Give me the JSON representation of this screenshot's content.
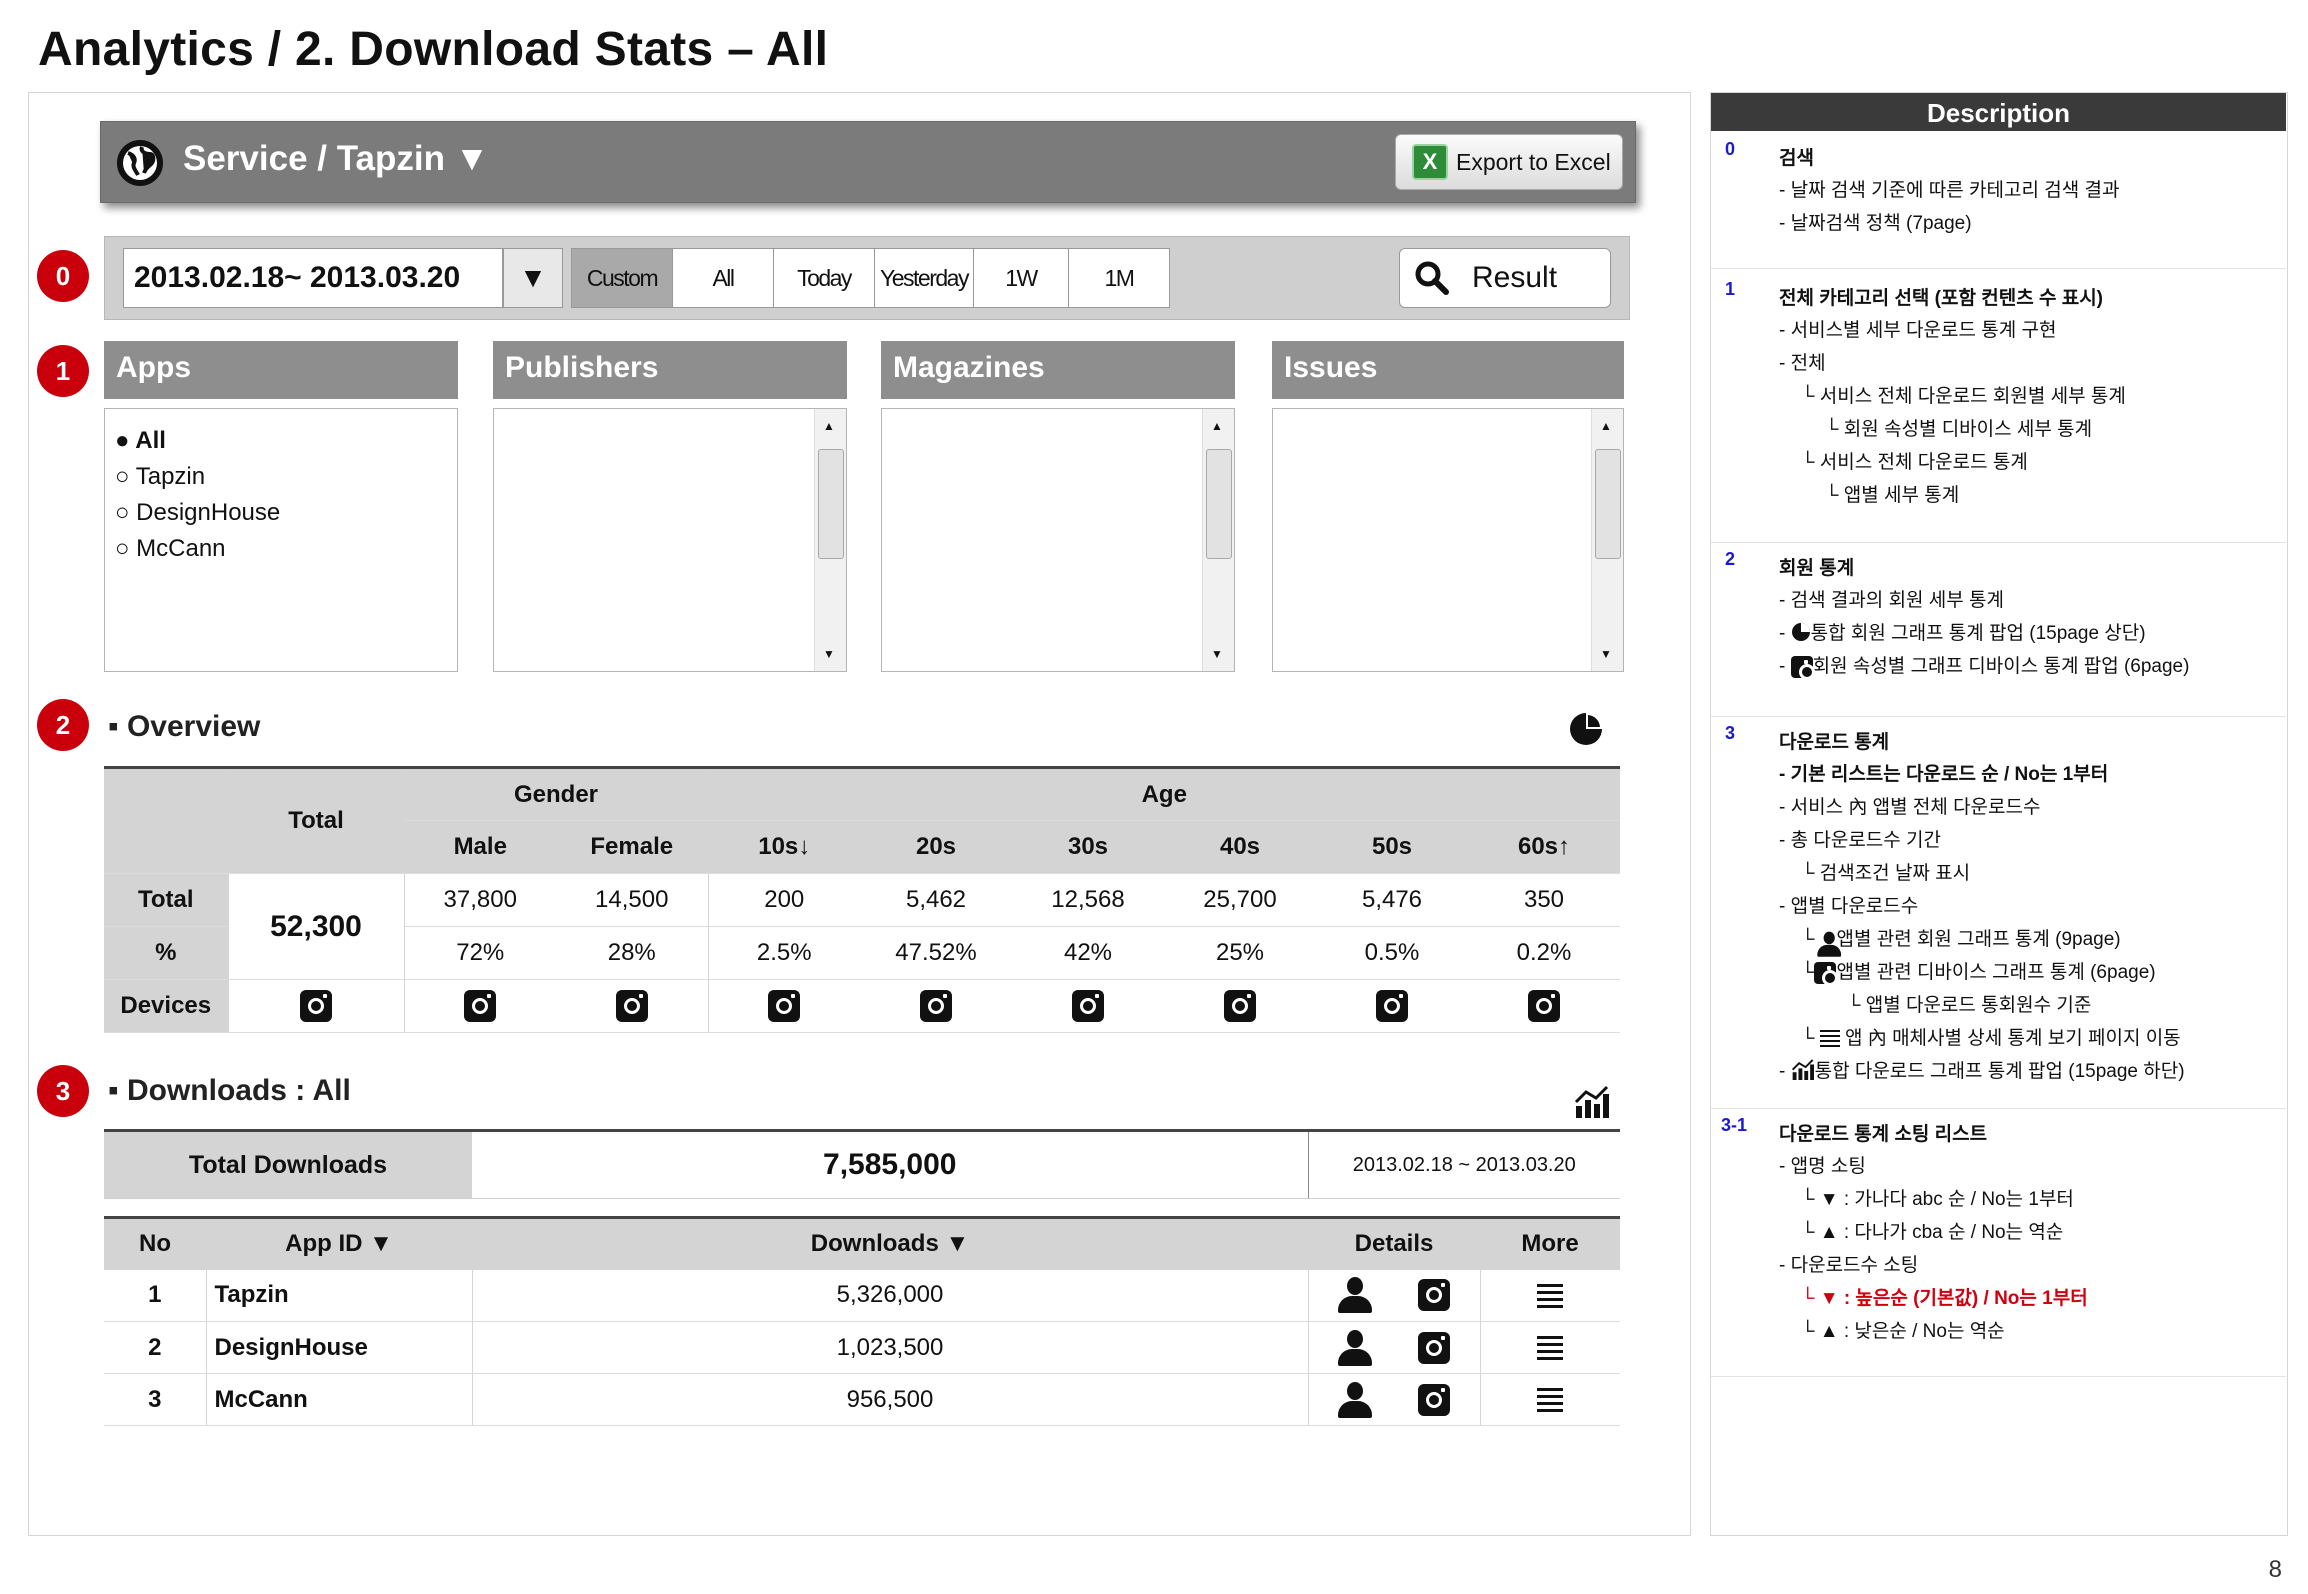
{
  "page": {
    "title": "Analytics / 2. Download Stats – All",
    "page_number": "8"
  },
  "header": {
    "service_title": "Service / Tapzin  ▼",
    "export_label": "Export to Excel"
  },
  "search": {
    "date_range": "2013.02.18~ 2013.03.20",
    "dropdown_glyph": "▼",
    "ranges": [
      "Custom",
      "All",
      "Today",
      "Yesterday",
      "1W",
      "1M"
    ],
    "selected_range": "Custom",
    "result_label": "Result"
  },
  "badges": [
    "0",
    "1",
    "2",
    "3"
  ],
  "categories": {
    "apps": {
      "title": "Apps",
      "items": [
        "● All",
        "○ Tapzin",
        "○ DesignHouse",
        "○ McCann"
      ]
    },
    "publishers": {
      "title": "Publishers"
    },
    "magazines": {
      "title": "Magazines"
    },
    "issues": {
      "title": "Issues"
    }
  },
  "overview": {
    "title": "▪ Overview",
    "header_total": "Total",
    "header_gender": "Gender",
    "header_age": "Age",
    "sub_headers": [
      "Male",
      "Female",
      "10s↓",
      "20s",
      "30s",
      "40s",
      "50s",
      "60s↑"
    ],
    "row_labels": [
      "Total",
      "%",
      "Devices"
    ],
    "total_value": "52,300",
    "totals": [
      "37,800",
      "14,500",
      "200",
      "5,462",
      "12,568",
      "25,700",
      "5,476",
      "350"
    ],
    "percents": [
      "72%",
      "28%",
      "2.5%",
      "47.52%",
      "42%",
      "25%",
      "0.5%",
      "0.2%"
    ]
  },
  "downloads": {
    "title": "▪ Downloads : All",
    "total_label": "Total Downloads",
    "total_value": "7,585,000",
    "date_range": "2013.02.18 ~ 2013.03.20",
    "headers": {
      "no": "No",
      "app_id": "App ID ▼",
      "downloads": "Downloads ▼",
      "details": "Details",
      "more": "More"
    },
    "rows": [
      {
        "no": "1",
        "app": "Tapzin",
        "downloads": "5,326,000"
      },
      {
        "no": "2",
        "app": "DesignHouse",
        "downloads": "1,023,500"
      },
      {
        "no": "3",
        "app": "McCann",
        "downloads": "956,500"
      }
    ]
  },
  "description": {
    "title": "Description",
    "s0": {
      "num": "0",
      "title": "검색",
      "lines": [
        "- 날짜 검색 기준에 따른 카테고리 검색 결과",
        "- 날짜검색 정책 (7page)"
      ]
    },
    "s1": {
      "num": "1",
      "title": "전체 카테고리 선택 (포함 컨텐츠 수 표시)",
      "lines": [
        "- 서비스별 세부 다운로드 통계 구현",
        "- 전체",
        "└ 서비스 전체 다운로드 회원별 세부 통계",
        "└ 회원 속성별 디바이스 세부 통계",
        "└ 서비스 전체 다운로드 통계",
        "└ 앱별 세부 통계"
      ]
    },
    "s2": {
      "num": "2",
      "title": "회원 통계",
      "lines": [
        "- 검색 결과의 회원 세부 통계",
        "통합 회원 그래프 통계 팝업 (15page 상단)",
        "회원 속성별 그래프 디바이스 통계 팝업 (6page)"
      ]
    },
    "s3": {
      "num": "3",
      "title": "다운로드 통계",
      "lines": [
        "- 기본 리스트는 다운로드 순 / No는 1부터",
        "- 서비스 內 앱별 전체 다운로드수",
        "- 총 다운로드수 기간",
        "└ 검색조건 날짜 표시",
        "- 앱별 다운로드수",
        "앱별 관련 회원 그래프 통계 (9page)",
        "앱별 관련 디바이스 그래프 통계 (6page)",
        "└ 앱별 다운로드 통회원수 기준",
        "앱 內 매체사별 상세 통계 보기 페이지 이동",
        "통합 다운로드 그래프 통계 팝업 (15page 하단)"
      ]
    },
    "s31": {
      "num": "3-1",
      "title": "다운로드 통계 소팅 리스트",
      "lines": [
        "- 앱명 소팅",
        "└ ▼ : 가나다 abc 순 / No는 1부터",
        "└ ▲ : 다나가 cba 순 / No는 역순",
        "-  다운로드수 소팅",
        "└ ▼ : 높은순 (기본값) / No는 1부터",
        "└ ▲ : 낮은순 / No는 역순"
      ]
    }
  },
  "colors": {
    "badge": "#c9000b",
    "header_bar": "#7b7b7b",
    "category_header": "#8e8e8e",
    "table_header": "#d4d4d4",
    "description_bar": "#3a3a3a",
    "desc_number": "#1a1ad0",
    "desc_highlight": "#d0000f"
  },
  "icons": [
    "globe-icon",
    "excel-icon",
    "search-icon",
    "pie-chart-icon",
    "line-chart-icon",
    "camera-icon",
    "person-icon",
    "menu-icon"
  ]
}
